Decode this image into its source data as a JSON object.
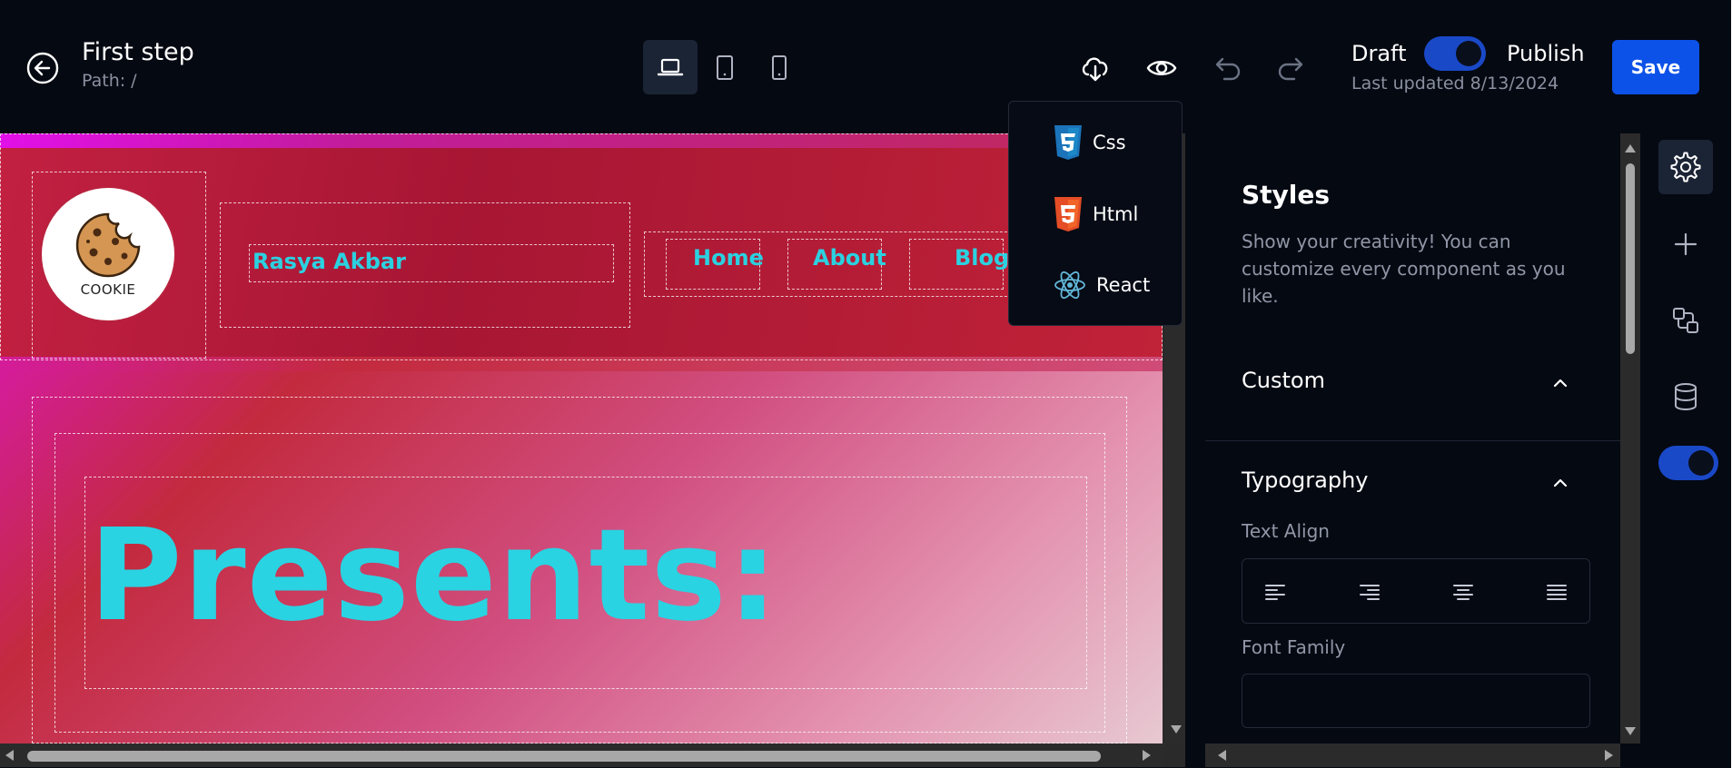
{
  "header": {
    "title": "First step",
    "path": "Path: /",
    "draft_label": "Draft",
    "publish_label": "Publish",
    "last_updated": "Last updated 8/13/2024",
    "save_label": "Save",
    "publish_toggle_on": true
  },
  "devices": [
    {
      "name": "desktop",
      "icon": "laptop-icon",
      "active": true
    },
    {
      "name": "tablet",
      "icon": "tablet-icon",
      "active": false
    },
    {
      "name": "mobile",
      "icon": "phone-icon",
      "active": false
    }
  ],
  "toolbar_icons": [
    "download-icon",
    "eye-icon",
    "undo-icon",
    "redo-icon"
  ],
  "export_menu": {
    "items": [
      {
        "label": "Css",
        "icon": "css3-icon"
      },
      {
        "label": "Html",
        "icon": "html5-icon"
      },
      {
        "label": "React",
        "icon": "react-icon"
      }
    ]
  },
  "canvas": {
    "logo_text": "COOKIE",
    "brand_name": "Rasya Akbar",
    "nav": [
      "Home",
      "About",
      "Blog"
    ],
    "hero_title": "Presents:",
    "accent_color": "#2bd1e0"
  },
  "panel": {
    "title": "Styles",
    "description": "Show your creativity! You can customize every component as you like.",
    "sections": [
      {
        "label": "Custom",
        "expanded": true
      },
      {
        "label": "Typography",
        "expanded": true
      }
    ],
    "text_align_label": "Text Align",
    "font_family_label": "Font Family",
    "font_family_value": "",
    "align_options": [
      "align-left-icon",
      "align-right-icon",
      "align-center-icon",
      "align-justify-icon"
    ]
  },
  "rail_icons": [
    "gear-icon",
    "plus-icon",
    "components-icon",
    "database-icon"
  ],
  "rail_toggle_on": true,
  "colors": {
    "background": "#050912",
    "primary": "#0d52e8",
    "toggle": "#1a49c8"
  }
}
